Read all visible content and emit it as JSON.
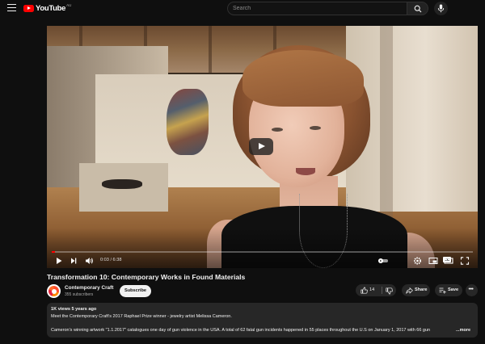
{
  "header": {
    "logo_text": "YouTube",
    "country_code": "AU",
    "search_placeholder": "Search",
    "icons": [
      "menu-icon",
      "search-icon",
      "mic-icon"
    ]
  },
  "player": {
    "current_time": "0:03",
    "duration": "6:38",
    "time_display": "0:03 / 6:38",
    "progress_fraction": 0.008,
    "cc_label": "CC",
    "controls": [
      "play-icon",
      "next-icon",
      "volume-icon",
      "autoplay-toggle",
      "cc-icon",
      "settings-icon",
      "miniplayer-icon",
      "theater-icon",
      "fullscreen-icon"
    ]
  },
  "video": {
    "title": "Transformation 10: Contemporary Works in Found Materials",
    "channel_name": "Contemporary Craft",
    "subscribers": "355 subscribers",
    "subscribe_label": "Subscribe",
    "likes": "14",
    "share_label": "Share",
    "save_label": "Save"
  },
  "description": {
    "stats": "1K views  5 years ago",
    "line1": "Meet the Contemporary Craft's 2017 Raphael Prize winner - jewelry artist Melissa Cameron.",
    "line2": "Cameron's winning artwork \"1.1.2017\" catalogues one day of gun violence in the USA. A total of 62 fatal gun incidents happened in 55 places throughout the U.S on January 1, 2017 with 66 gun",
    "more_label": "...more"
  },
  "colors": {
    "background": "#0f0f0f",
    "brand_red": "#ff0000",
    "button_bg": "#272727",
    "text": "#f1f1f1",
    "secondary_text": "#aaaaaa"
  }
}
